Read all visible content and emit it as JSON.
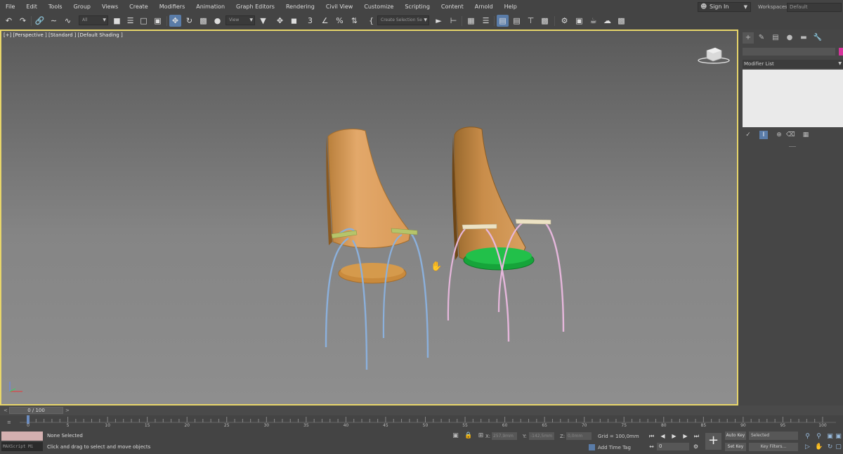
{
  "menubar": {
    "items": [
      "File",
      "Edit",
      "Tools",
      "Group",
      "Views",
      "Create",
      "Modifiers",
      "Animation",
      "Graph Editors",
      "Rendering",
      "Civil View",
      "Customize",
      "Scripting",
      "Content",
      "Arnold",
      "Help"
    ],
    "sign_in": "Sign In",
    "workspaces_label": "Workspaces:",
    "workspace_value": "Default"
  },
  "toolbar": {
    "selection_filter": "All",
    "reference_coord": "View",
    "named_selection": "Create Selection Se"
  },
  "viewport": {
    "label": "[+] [Perspective ] [Standard ] [Default Shading ]"
  },
  "command_panel": {
    "modifier_list": "Modifier List",
    "object_color": "#d6349b"
  },
  "time_slider": {
    "value": "0 / 100",
    "prev": "<",
    "next": ">"
  },
  "track_bar": {
    "labels": [
      "0",
      "5",
      "10",
      "15",
      "20",
      "25",
      "30",
      "35",
      "40",
      "45",
      "50",
      "55",
      "60",
      "65",
      "70",
      "75",
      "80",
      "85",
      "90",
      "95",
      "100"
    ]
  },
  "status": {
    "maxscript_placeholder": "MAXScript Mi",
    "selection": "None Selected",
    "prompt": "Click and drag to select and move objects",
    "x_label": "X:",
    "x_value": "257,9mm",
    "y_label": "Y:",
    "y_value": "-142,5mm",
    "z_label": "Z:",
    "z_value": "0,0mm",
    "grid": "Grid = 100,0mm",
    "add_time_tag": "Add Time Tag",
    "frame": "0",
    "auto_key": "Auto Key",
    "set_key": "Set Key",
    "key_selection": "Selected",
    "key_filters": "Key Filters..."
  },
  "colors": {
    "viewport_border": "#e8d66a",
    "active_button": "#5a7ca8"
  }
}
